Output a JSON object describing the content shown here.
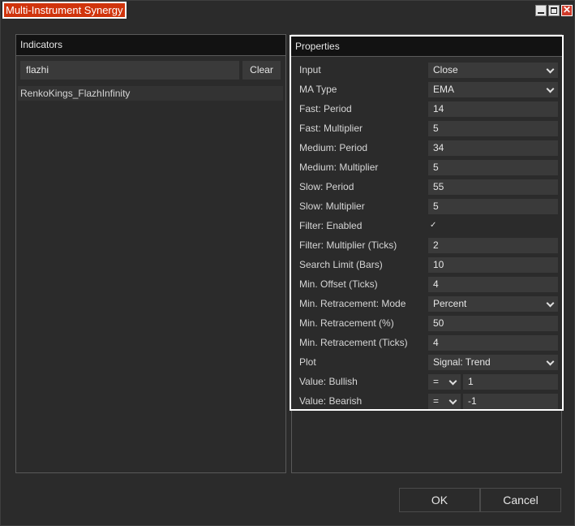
{
  "window": {
    "title": "Multi-Instrument Synergy"
  },
  "indicators": {
    "header": "Indicators",
    "search_value": "flazhi",
    "clear_label": "Clear",
    "items": [
      "RenkoKings_FlazhInfinity"
    ]
  },
  "properties": {
    "header": "Properties",
    "rows": [
      {
        "label": "Input",
        "value": "Close",
        "kind": "select"
      },
      {
        "label": "MA Type",
        "value": "EMA",
        "kind": "select"
      },
      {
        "label": "Fast: Period",
        "value": "14",
        "kind": "text"
      },
      {
        "label": "Fast: Multiplier",
        "value": "5",
        "kind": "text"
      },
      {
        "label": "Medium: Period",
        "value": "34",
        "kind": "text"
      },
      {
        "label": "Medium: Multiplier",
        "value": "5",
        "kind": "text"
      },
      {
        "label": "Slow: Period",
        "value": "55",
        "kind": "text"
      },
      {
        "label": "Slow: Multiplier",
        "value": "5",
        "kind": "text"
      },
      {
        "label": "Filter: Enabled",
        "value": true,
        "kind": "checkbox"
      },
      {
        "label": "Filter: Multiplier (Ticks)",
        "value": "2",
        "kind": "text"
      },
      {
        "label": "Search Limit (Bars)",
        "value": "10",
        "kind": "text"
      },
      {
        "label": "Min. Offset (Ticks)",
        "value": "4",
        "kind": "text"
      },
      {
        "label": "Min. Retracement: Mode",
        "value": "Percent",
        "kind": "select"
      },
      {
        "label": "Min. Retracement (%)",
        "value": "50",
        "kind": "text"
      },
      {
        "label": "Min. Retracement (Ticks)",
        "value": "4",
        "kind": "text"
      },
      {
        "label": "Plot",
        "value": "Signal: Trend",
        "kind": "select"
      },
      {
        "label": "Value: Bullish",
        "op": "=",
        "value": "1",
        "kind": "compare"
      },
      {
        "label": "Value: Bearish",
        "op": "=",
        "value": "-1",
        "kind": "compare"
      }
    ]
  },
  "footer": {
    "ok_label": "OK",
    "cancel_label": "Cancel"
  },
  "colors": {
    "title_bg": "#d0340c",
    "panel_bg": "#2b2b2b",
    "header_bg": "#121212",
    "field_bg": "#3a3a3a"
  }
}
